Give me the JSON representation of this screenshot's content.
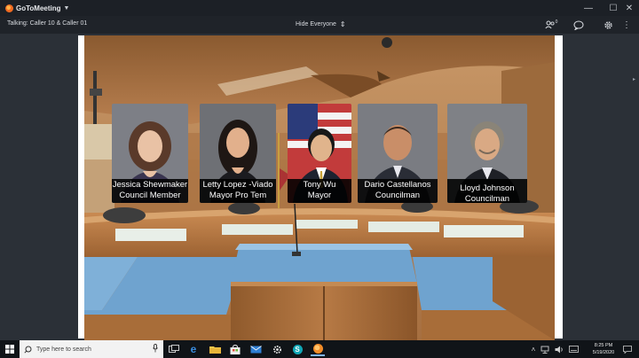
{
  "app": {
    "name": "GoToMeeting"
  },
  "header": {
    "talking": "Talking: Caller 10 & Caller 01",
    "hide_label": "Hide Everyone",
    "attendee_count": "0"
  },
  "panel": {
    "people": [
      {
        "name": "Jessica Shewmaker",
        "title": "Council Member"
      },
      {
        "name": "Letty Lopez -Viado",
        "title": "Mayor Pro Tem"
      },
      {
        "name": "Tony Wu",
        "title": "Mayor"
      },
      {
        "name": "Dario Castellanos",
        "title": "Councilman"
      },
      {
        "name": "Lloyd Johnson",
        "title": "Councilman"
      }
    ]
  },
  "taskbar": {
    "search_placeholder": "Type here to search",
    "time": "8:25 PM",
    "date": "5/19/2020"
  },
  "colors": {
    "wood": "#b57a45",
    "desk_top": "#6fa3cf",
    "title_bar": "#1c2026",
    "accent": "#f26b21"
  }
}
